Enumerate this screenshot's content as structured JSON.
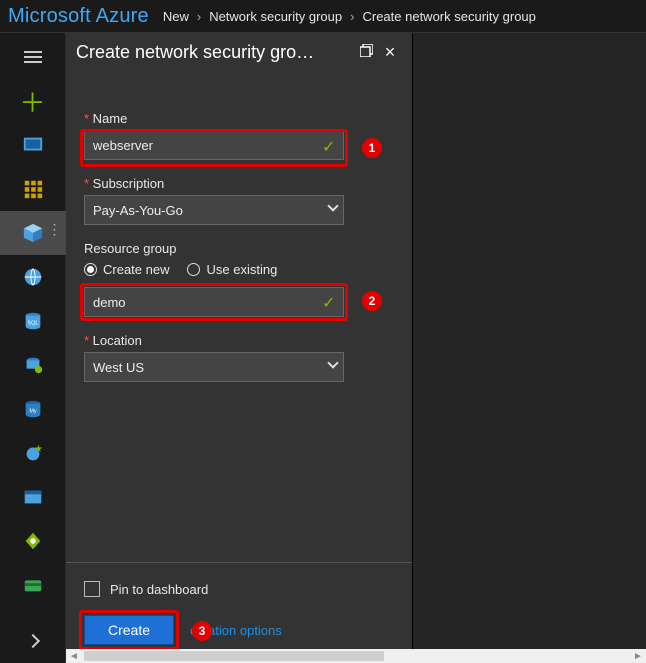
{
  "brand": "Microsoft Azure",
  "breadcrumb": [
    "New",
    "Network security group",
    "Create network security group"
  ],
  "rail": {
    "items": [
      {
        "name": "menu"
      },
      {
        "name": "add"
      },
      {
        "name": "dashboard"
      },
      {
        "name": "all-resources"
      },
      {
        "name": "resource-groups",
        "selected": true
      },
      {
        "name": "web"
      },
      {
        "name": "sql"
      },
      {
        "name": "cloud-services"
      },
      {
        "name": "virtual-machines"
      },
      {
        "name": "app-services"
      },
      {
        "name": "storage"
      },
      {
        "name": "networking"
      },
      {
        "name": "billing"
      }
    ],
    "expand": "expand"
  },
  "blade": {
    "title": "Create network security gro…",
    "restore_label": "Restore",
    "close_label": "Close",
    "fields": {
      "name": {
        "label": "Name",
        "value": "webserver",
        "required": true,
        "callout": "1"
      },
      "subscription": {
        "label": "Subscription",
        "value": "Pay-As-You-Go",
        "required": true
      },
      "resource_group": {
        "label": "Resource group",
        "required": false,
        "mode_labels": {
          "create": "Create new",
          "existing": "Use existing"
        },
        "mode": "create",
        "value": "demo",
        "callout": "2"
      },
      "location": {
        "label": "Location",
        "value": "West US",
        "required": true
      }
    },
    "footer": {
      "pin_label": "Pin to dashboard",
      "pin_checked": false,
      "create_label": "Create",
      "automation_link_visible": "omation options",
      "automation_link_full": "Automation options",
      "callout": "3"
    }
  }
}
